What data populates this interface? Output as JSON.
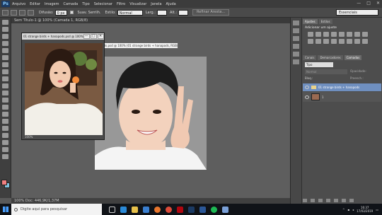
{
  "app": {
    "logo": "Ps"
  },
  "menu": [
    "Arquivo",
    "Editar",
    "Imagem",
    "Camada",
    "Tipo",
    "Selecionar",
    "Filtro",
    "Visualizar",
    "Janela",
    "Ajuda"
  ],
  "window_controls": [
    "—",
    "□",
    "✕"
  ],
  "options": {
    "difusao_label": "Difusão:",
    "difusao_value": "0 px",
    "suavizado_label": "Suav. Serrilh.",
    "estilo_label": "Estilo:",
    "estilo_value": "Normal",
    "largura_label": "Larg.:",
    "altura_label": "Alt.:",
    "refine_button": "Refinar Aresta...",
    "workspace": "Essenciais"
  },
  "document": {
    "tab_label": "Sem Título-1 @ 100% (Camada 1, RGB/8)",
    "status_text": "100%     Doc: 446,9K/1,37M"
  },
  "tooltip": {
    "text": "01 strange birds + hanapods.psd @ 100% (01 strange birds + hanapods, RGB/8)"
  },
  "float_window": {
    "title": "01 strange birds + hanapods.psd @ 100%",
    "buttons": [
      "—",
      "□",
      "✕"
    ],
    "zoom": "100%"
  },
  "panels": {
    "adjust_tabs": [
      "Ajustes",
      "Estilos"
    ],
    "adjust_add": "Adicionar um ajuste",
    "layers_tabs": [
      "Canais",
      "Demarcadores",
      "Camadas"
    ],
    "filter": "Tipo",
    "blend_mode": "Normal",
    "opacity_label": "Opacidade:",
    "lock_label": "Bloq.:",
    "fill_label": "Preench.:",
    "group_name": "01 strange birds + hanapods",
    "layer_name": "1"
  },
  "taskbar": {
    "search_placeholder": "Digite aqui para pesquisar",
    "time": "16:37",
    "date": "17/03/2019"
  },
  "colors": {
    "foreground": "#f08080",
    "background": "#7fc4e0",
    "selected_layer": "#6f8fbf"
  }
}
